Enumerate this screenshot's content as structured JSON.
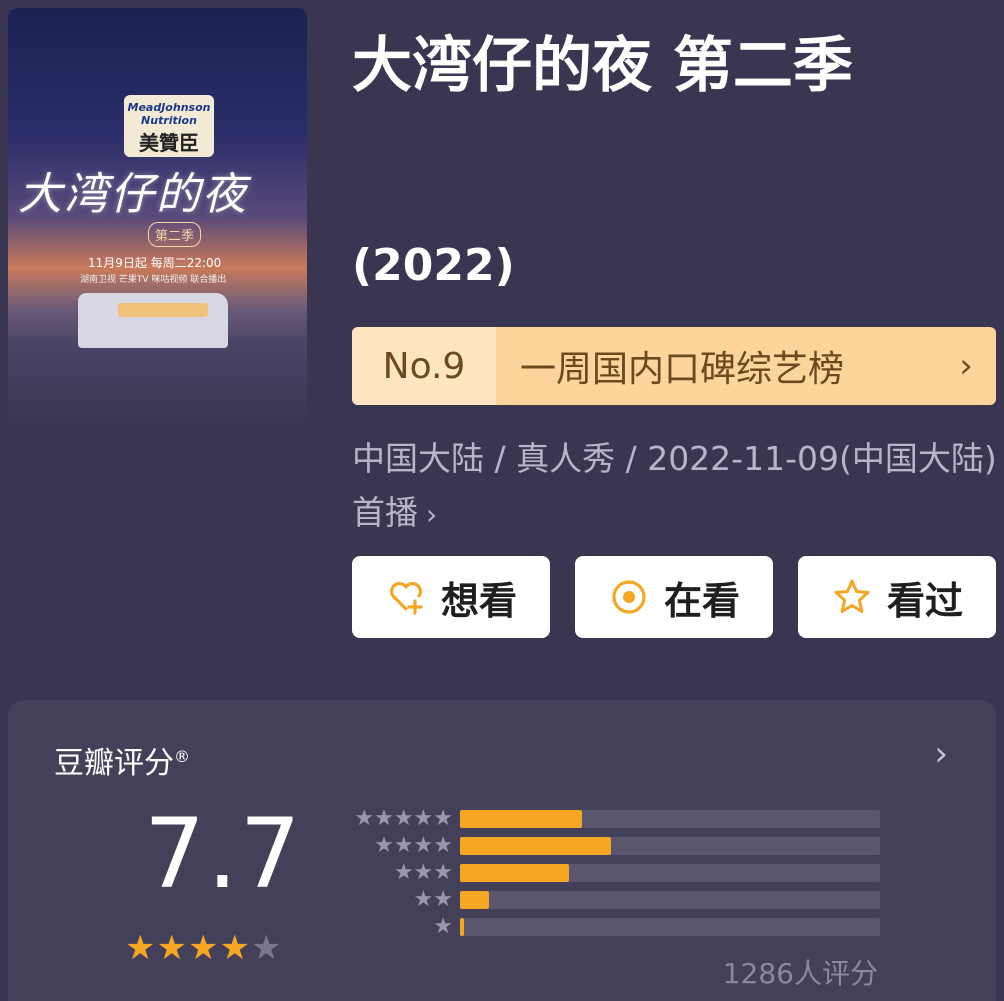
{
  "poster": {
    "brand_en": "MeadJohnson Nutrition",
    "brand_cn": "美贊臣",
    "title_art": "大湾仔的夜",
    "season": "第二季",
    "air_info": "11月9日起 每周二22:00",
    "partners": "湖南卫视 芒果TV 咪咕视频 联合播出"
  },
  "show": {
    "title": "大湾仔的夜 第二季",
    "year": "(2022)"
  },
  "ranking": {
    "number": "No.9",
    "list_name": "一周国内口碑综艺榜",
    "chevron": "›"
  },
  "meta": {
    "text": "中国大陆 / 真人秀 / 2022-11-09(中国大陆)首播",
    "chevron": "›"
  },
  "actions": {
    "want": "想看",
    "watching": "在看",
    "watched": "看过"
  },
  "rating": {
    "label": "豆瓣评分",
    "registered": "®",
    "score": "7.7",
    "star_rating": 4,
    "count_text": "1286人评分",
    "distribution": [
      {
        "stars": "★★★★★",
        "fraction": 0.29
      },
      {
        "stars": "★★★★",
        "fraction": 0.36
      },
      {
        "stars": "★★★",
        "fraction": 0.26
      },
      {
        "stars": "★★",
        "fraction": 0.07
      },
      {
        "stars": "★",
        "fraction": 0.01
      }
    ],
    "more_chevron": "›"
  },
  "colors": {
    "background": "#3a3550",
    "accent": "#f5a623",
    "rank_bg": "#fbd59b"
  }
}
